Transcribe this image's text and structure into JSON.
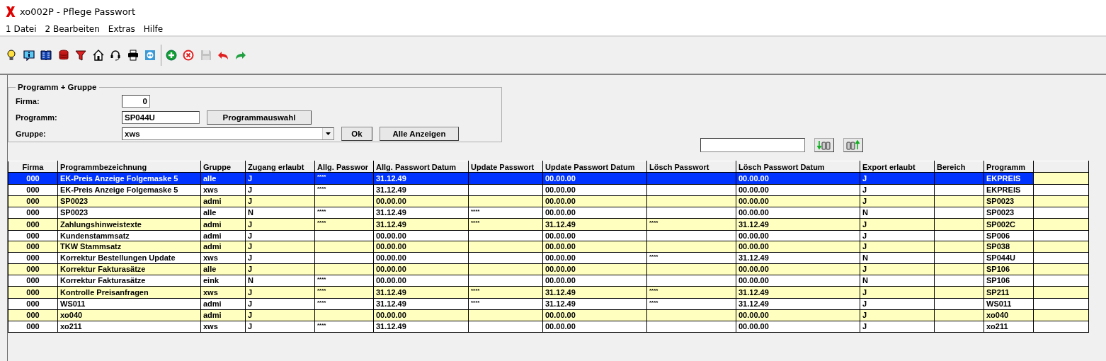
{
  "window": {
    "title": "xo002P - Pflege Passwort"
  },
  "menu": [
    "1 Datei",
    "2 Bearbeiten",
    "Extras",
    "Hilfe"
  ],
  "toolbar": [
    {
      "kind": "bulb",
      "disabled": false
    },
    {
      "kind": "info",
      "disabled": false
    },
    {
      "kind": "book",
      "disabled": false
    },
    {
      "kind": "database",
      "disabled": false
    },
    {
      "kind": "filter",
      "disabled": false
    },
    {
      "kind": "home",
      "disabled": false
    },
    {
      "kind": "headset",
      "disabled": false
    },
    {
      "kind": "printer",
      "disabled": false
    },
    {
      "kind": "remote",
      "disabled": false
    },
    {
      "kind": "separator"
    },
    {
      "kind": "add",
      "disabled": false
    },
    {
      "kind": "cancel",
      "disabled": false
    },
    {
      "kind": "save",
      "disabled": true
    },
    {
      "kind": "undo",
      "disabled": false
    },
    {
      "kind": "redo",
      "disabled": false
    }
  ],
  "group": {
    "title": "Programm + Gruppe",
    "firma": {
      "label": "Firma:",
      "value": "0"
    },
    "programm": {
      "label": "Programm:",
      "value": "SP044U",
      "button": "Programmauswahl"
    },
    "gruppe": {
      "label": "Gruppe:",
      "value": "xws",
      "buttons": [
        "Ok",
        "Alle Anzeigen"
      ]
    }
  },
  "table": {
    "columns": [
      "Firma",
      "Programmbezeichnung",
      "Gruppe",
      "Zugang erlaubt",
      "Allg. Passwor",
      "Allg. Passwort Datum",
      "Update Passwort",
      "Update Passwort Datum",
      "Lösch Passwort",
      "Lösch Passwort Datum",
      "Export erlaubt",
      "Bereich",
      "Programm"
    ],
    "rows": [
      {
        "selected": true,
        "shaded": true,
        "cells": [
          "000",
          "EK-Preis Anzeige Folgemaske 5",
          "alle",
          "J",
          "****",
          "31.12.49",
          null,
          "00.00.00",
          null,
          "00.00.00",
          "J",
          null,
          "EKPREIS"
        ]
      },
      {
        "selected": false,
        "shaded": false,
        "cells": [
          "000",
          "EK-Preis Anzeige Folgemaske 5",
          "xws",
          "J",
          "****",
          "31.12.49",
          null,
          "00.00.00",
          null,
          "00.00.00",
          "J",
          null,
          "EKPREIS"
        ]
      },
      {
        "selected": false,
        "shaded": true,
        "cells": [
          "000",
          "SP0023",
          "admi",
          "J",
          null,
          "00.00.00",
          null,
          "00.00.00",
          null,
          "00.00.00",
          "J",
          null,
          "SP0023"
        ]
      },
      {
        "selected": false,
        "shaded": false,
        "cells": [
          "000",
          "SP0023",
          "alle",
          "N",
          "****",
          "31.12.49",
          "****",
          "00.00.00",
          null,
          "00.00.00",
          "N",
          null,
          "SP0023"
        ]
      },
      {
        "selected": false,
        "shaded": true,
        "cells": [
          "000",
          "Zahlungshinweistexte",
          "admi",
          "J",
          "****",
          "31.12.49",
          "****",
          "31.12.49",
          "****",
          "31.12.49",
          "J",
          null,
          "SP002C"
        ]
      },
      {
        "selected": false,
        "shaded": false,
        "cells": [
          "000",
          "Kundenstammsatz",
          "admi",
          "J",
          null,
          "00.00.00",
          null,
          "00.00.00",
          null,
          "00.00.00",
          "J",
          null,
          "SP006"
        ]
      },
      {
        "selected": false,
        "shaded": true,
        "cells": [
          "000",
          "TKW Stammsatz",
          "admi",
          "J",
          null,
          "00.00.00",
          null,
          "00.00.00",
          null,
          "00.00.00",
          "J",
          null,
          "SP038"
        ]
      },
      {
        "selected": false,
        "shaded": false,
        "cells": [
          "000",
          "Korrektur Bestellungen Update",
          "xws",
          "J",
          null,
          "00.00.00",
          null,
          "00.00.00",
          "****",
          "31.12.49",
          "N",
          null,
          "SP044U"
        ]
      },
      {
        "selected": false,
        "shaded": true,
        "cells": [
          "000",
          "Korrektur Fakturasätze",
          "alle",
          "J",
          null,
          "00.00.00",
          null,
          "00.00.00",
          null,
          "00.00.00",
          "J",
          null,
          "SP106"
        ]
      },
      {
        "selected": false,
        "shaded": false,
        "cells": [
          "000",
          "Korrektur Fakturasätze",
          "eink",
          "N",
          "****",
          "00.00.00",
          null,
          "00.00.00",
          null,
          "00.00.00",
          "N",
          null,
          "SP106"
        ]
      },
      {
        "selected": false,
        "shaded": true,
        "cells": [
          "000",
          "Kontrolle Preisanfragen",
          "xws",
          "J",
          "****",
          "31.12.49",
          "****",
          "31.12.49",
          "****",
          "31.12.49",
          "J",
          null,
          "SP211"
        ]
      },
      {
        "selected": false,
        "shaded": false,
        "cells": [
          "000",
          "WS011",
          "admi",
          "J",
          "****",
          "31.12.49",
          "****",
          "31.12.49",
          "****",
          "31.12.49",
          "J",
          null,
          "WS011"
        ]
      },
      {
        "selected": false,
        "shaded": true,
        "cells": [
          "000",
          "xo040",
          "admi",
          "J",
          null,
          "00.00.00",
          null,
          "00.00.00",
          null,
          "00.00.00",
          "J",
          null,
          "xo040"
        ]
      },
      {
        "selected": false,
        "shaded": false,
        "cells": [
          "000",
          "xo211",
          "xws",
          "J",
          "****",
          "31.12.49",
          null,
          "00.00.00",
          null,
          "00.00.00",
          "J",
          null,
          "xo211"
        ]
      }
    ]
  }
}
